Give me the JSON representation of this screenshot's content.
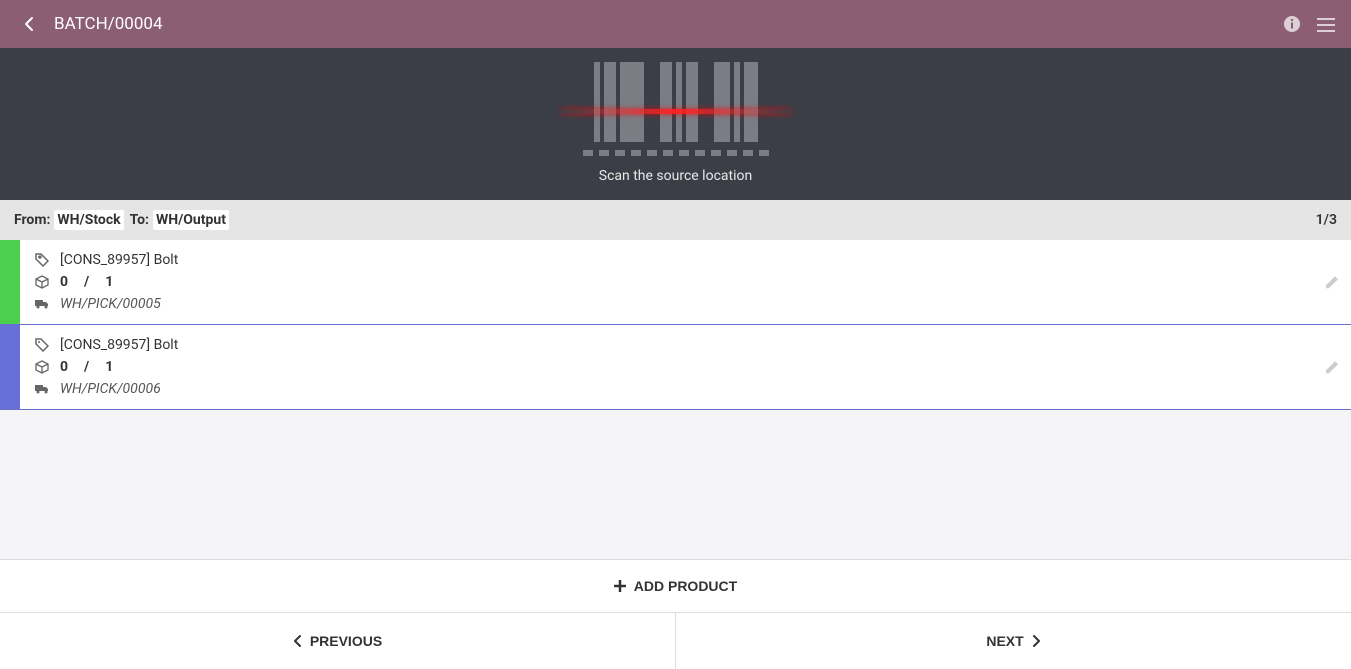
{
  "header": {
    "title": "BATCH/00004"
  },
  "scanner": {
    "instruction": "Scan the source location"
  },
  "location": {
    "from_label": "From:",
    "from_value": "WH/Stock",
    "to_label": "To:",
    "to_value": "WH/Output",
    "page_current": "1",
    "page_total": "3"
  },
  "items": [
    {
      "color": "green",
      "product": "[CONS_89957] Bolt",
      "qty_done": "0",
      "qty_total": "1",
      "pick": "WH/PICK/00005"
    },
    {
      "color": "blue",
      "product": "[CONS_89957] Bolt",
      "qty_done": "0",
      "qty_total": "1",
      "pick": "WH/PICK/00006"
    }
  ],
  "actions": {
    "add_product": "ADD PRODUCT",
    "previous": "PREVIOUS",
    "next": "NEXT"
  }
}
